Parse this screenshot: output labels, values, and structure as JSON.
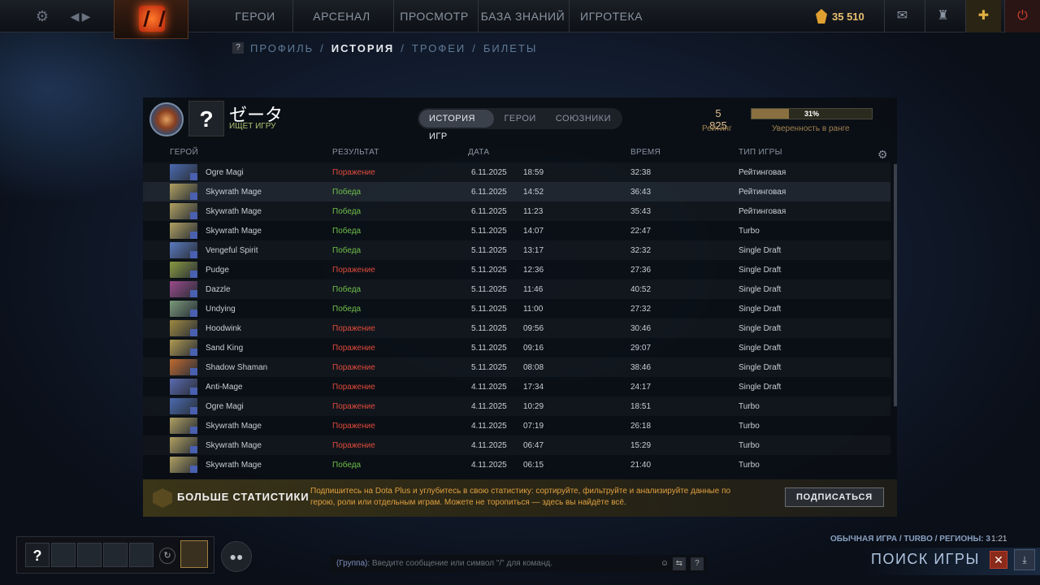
{
  "topbar": {
    "nav": [
      "ГЕРОИ",
      "АРСЕНАЛ",
      "ПРОСМОТР",
      "БАЗА ЗНАНИЙ",
      "ИГРОТЕКА"
    ],
    "shards": "35 510",
    "icons": {
      "settings": "gear-icon",
      "back": "back-icon",
      "forward": "forward-icon",
      "mail": "mail-icon",
      "armory": "tower-icon",
      "plus": "dota-plus-icon",
      "power": "power-icon"
    }
  },
  "subnav": {
    "help": "?",
    "items": [
      "ПРОФИЛЬ",
      "ИСТОРИЯ",
      "ТРОФЕИ",
      "БИЛЕТЫ"
    ],
    "active": 1,
    "sep": "/"
  },
  "profile": {
    "avatar": "?",
    "name": "ゼータ",
    "status": "ИЩЕТ ИГРУ",
    "tabs": [
      "ИСТОРИЯ ИГР",
      "ГЕРОИ",
      "СОЮЗНИКИ"
    ],
    "active_tab": 0,
    "rating": "5 825",
    "rating_label": "Рейтинг",
    "confidence": "31%",
    "confidence_fraction": 0.31,
    "confidence_label": "Уверенность в ранге"
  },
  "table": {
    "headers": {
      "hero": "ГЕРОЙ",
      "result": "РЕЗУЛЬТАТ",
      "date": "ДАТА",
      "time": "ВРЕМЯ",
      "type": "ТИП ИГРЫ"
    },
    "rows": [
      {
        "hero": "Ogre Magi",
        "result": "Поражение",
        "win": false,
        "date": "6.11.2025",
        "start": "18:59",
        "duration": "32:38",
        "type": "Рейтинговая",
        "color": "#4a6ab0"
      },
      {
        "hero": "Skywrath Mage",
        "result": "Победа",
        "win": true,
        "date": "6.11.2025",
        "start": "14:52",
        "duration": "36:43",
        "type": "Рейтинговая",
        "color": "#b0a060"
      },
      {
        "hero": "Skywrath Mage",
        "result": "Победа",
        "win": true,
        "date": "6.11.2025",
        "start": "11:23",
        "duration": "35:43",
        "type": "Рейтинговая",
        "color": "#b0a060"
      },
      {
        "hero": "Skywrath Mage",
        "result": "Победа",
        "win": true,
        "date": "5.11.2025",
        "start": "14:07",
        "duration": "22:47",
        "type": "Turbo",
        "color": "#b0a060"
      },
      {
        "hero": "Vengeful Spirit",
        "result": "Победа",
        "win": true,
        "date": "5.11.2025",
        "start": "13:17",
        "duration": "32:32",
        "type": "Single Draft",
        "color": "#5a7ac0"
      },
      {
        "hero": "Pudge",
        "result": "Поражение",
        "win": false,
        "date": "5.11.2025",
        "start": "12:36",
        "duration": "27:36",
        "type": "Single Draft",
        "color": "#8a9a40"
      },
      {
        "hero": "Dazzle",
        "result": "Победа",
        "win": true,
        "date": "5.11.2025",
        "start": "11:46",
        "duration": "40:52",
        "type": "Single Draft",
        "color": "#9a4a8a"
      },
      {
        "hero": "Undying",
        "result": "Победа",
        "win": true,
        "date": "5.11.2025",
        "start": "11:00",
        "duration": "27:32",
        "type": "Single Draft",
        "color": "#7a9a7a"
      },
      {
        "hero": "Hoodwink",
        "result": "Поражение",
        "win": false,
        "date": "5.11.2025",
        "start": "09:56",
        "duration": "30:46",
        "type": "Single Draft",
        "color": "#a08a40"
      },
      {
        "hero": "Sand King",
        "result": "Поражение",
        "win": false,
        "date": "5.11.2025",
        "start": "09:16",
        "duration": "29:07",
        "type": "Single Draft",
        "color": "#b09a50"
      },
      {
        "hero": "Shadow Shaman",
        "result": "Поражение",
        "win": false,
        "date": "5.11.2025",
        "start": "08:08",
        "duration": "38:46",
        "type": "Single Draft",
        "color": "#c06a30"
      },
      {
        "hero": "Anti-Mage",
        "result": "Поражение",
        "win": false,
        "date": "4.11.2025",
        "start": "17:34",
        "duration": "24:17",
        "type": "Single Draft",
        "color": "#5a6ab0"
      },
      {
        "hero": "Ogre Magi",
        "result": "Поражение",
        "win": false,
        "date": "4.11.2025",
        "start": "10:29",
        "duration": "18:51",
        "type": "Turbo",
        "color": "#4a6ab0"
      },
      {
        "hero": "Skywrath Mage",
        "result": "Поражение",
        "win": false,
        "date": "4.11.2025",
        "start": "07:19",
        "duration": "26:18",
        "type": "Turbo",
        "color": "#b0a060"
      },
      {
        "hero": "Skywrath Mage",
        "result": "Поражение",
        "win": false,
        "date": "4.11.2025",
        "start": "06:47",
        "duration": "15:29",
        "type": "Turbo",
        "color": "#b0a060"
      },
      {
        "hero": "Skywrath Mage",
        "result": "Победа",
        "win": true,
        "date": "4.11.2025",
        "start": "06:15",
        "duration": "21:40",
        "type": "Turbo",
        "color": "#b0a060"
      }
    ],
    "highlight_row": 1
  },
  "plus": {
    "title": "БОЛЬШЕ СТАТИСТИКИ",
    "desc": "Подпишитесь на Dota Plus и углубитесь в свою статистику: сортируйте, фильтруйте и анализируйте данные по герою, роли или отдельным играм. Можете не торопиться — здесь вы найдёте всё.",
    "button": "ПОДПИСАТЬСЯ"
  },
  "bottom": {
    "party_me": "?",
    "chat_group": "(Группа):",
    "chat_placeholder": "Введите сообщение или символ \"/\" для команд.",
    "chat_help": "?",
    "queue_info": "ОБЫЧНАЯ ИГРА / TURBO / РЕГИОНЫ: 3",
    "queue_time": "1:21",
    "find_label": "ПОИСК ИГРЫ",
    "cancel": "✕"
  }
}
